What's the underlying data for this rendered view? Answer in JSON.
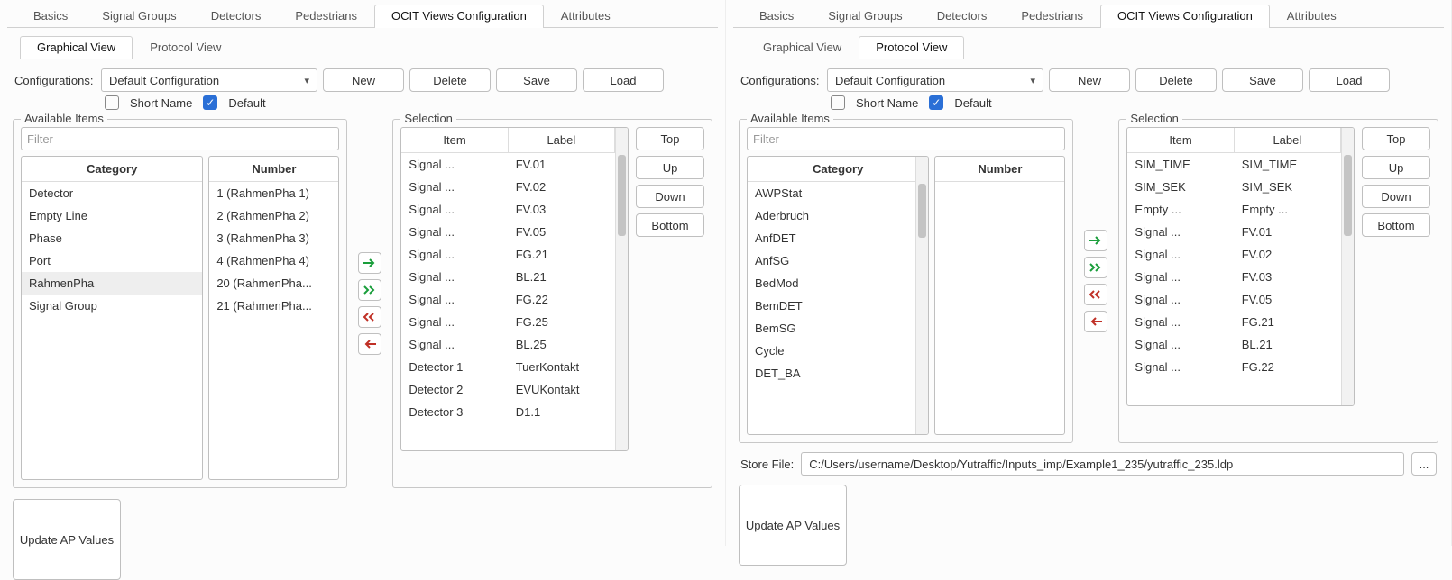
{
  "tabs": [
    "Basics",
    "Signal Groups",
    "Detectors",
    "Pedestrians",
    "OCIT Views Configuration",
    "Attributes"
  ],
  "active_tab": "OCIT Views Configuration",
  "subtabs": [
    "Graphical View",
    "Protocol View"
  ],
  "cfg_label": "Configurations:",
  "cfg_value": "Default Configuration",
  "btn_new": "New",
  "btn_delete": "Delete",
  "btn_save": "Save",
  "btn_load": "Load",
  "short_name_label": "Short Name",
  "default_label": "Default",
  "available_legend": "Available Items",
  "selection_legend": "Selection",
  "filter_placeholder": "Filter",
  "category_header": "Category",
  "number_header": "Number",
  "item_header": "Item",
  "label_header": "Label",
  "btn_top": "Top",
  "btn_up": "Up",
  "btn_down": "Down",
  "btn_bottom": "Bottom",
  "btn_update": "Update AP Values",
  "store_label": "Store File:",
  "store_path": "C:/Users/username/Desktop/Yutraffic/Inputs_imp/Example1_235/yutraffic_235.ldp",
  "ellipsis": "...",
  "left": {
    "active_subtab": "Graphical View",
    "categories": [
      "Detector",
      "Empty Line",
      "Phase",
      "Port",
      "RahmenPha",
      "Signal Group"
    ],
    "selected_category": "RahmenPha",
    "numbers": [
      "1 (RahmenPha 1)",
      "2 (RahmenPha 2)",
      "3 (RahmenPha 3)",
      "4 (RahmenPha 4)",
      "20 (RahmenPha...",
      "21 (RahmenPha..."
    ],
    "selection": [
      {
        "item": "Signal ...",
        "label": "FV.01"
      },
      {
        "item": "Signal ...",
        "label": "FV.02"
      },
      {
        "item": "Signal ...",
        "label": "FV.03"
      },
      {
        "item": "Signal ...",
        "label": "FV.05"
      },
      {
        "item": "Signal ...",
        "label": "FG.21"
      },
      {
        "item": "Signal ...",
        "label": "BL.21"
      },
      {
        "item": "Signal ...",
        "label": "FG.22"
      },
      {
        "item": "Signal ...",
        "label": "FG.25"
      },
      {
        "item": "Signal ...",
        "label": "BL.25"
      },
      {
        "item": "Detector 1",
        "label": "TuerKontakt"
      },
      {
        "item": "Detector 2",
        "label": "EVUKontakt"
      },
      {
        "item": "Detector 3",
        "label": "D1.1"
      }
    ]
  },
  "right": {
    "active_subtab": "Protocol View",
    "categories": [
      "AWPStat",
      "Aderbruch",
      "AnfDET",
      "AnfSG",
      "BedMod",
      "BemDET",
      "BemSG",
      "Cycle",
      "DET_BA"
    ],
    "numbers": [],
    "selection": [
      {
        "item": "SIM_TIME",
        "label": "SIM_TIME"
      },
      {
        "item": "SIM_SEK",
        "label": "SIM_SEK"
      },
      {
        "item": "Empty ...",
        "label": "Empty ..."
      },
      {
        "item": "Signal ...",
        "label": "FV.01"
      },
      {
        "item": "Signal ...",
        "label": "FV.02"
      },
      {
        "item": "Signal ...",
        "label": "FV.03"
      },
      {
        "item": "Signal ...",
        "label": "FV.05"
      },
      {
        "item": "Signal ...",
        "label": "FG.21"
      },
      {
        "item": "Signal ...",
        "label": "BL.21"
      },
      {
        "item": "Signal ...",
        "label": "FG.22"
      }
    ]
  }
}
